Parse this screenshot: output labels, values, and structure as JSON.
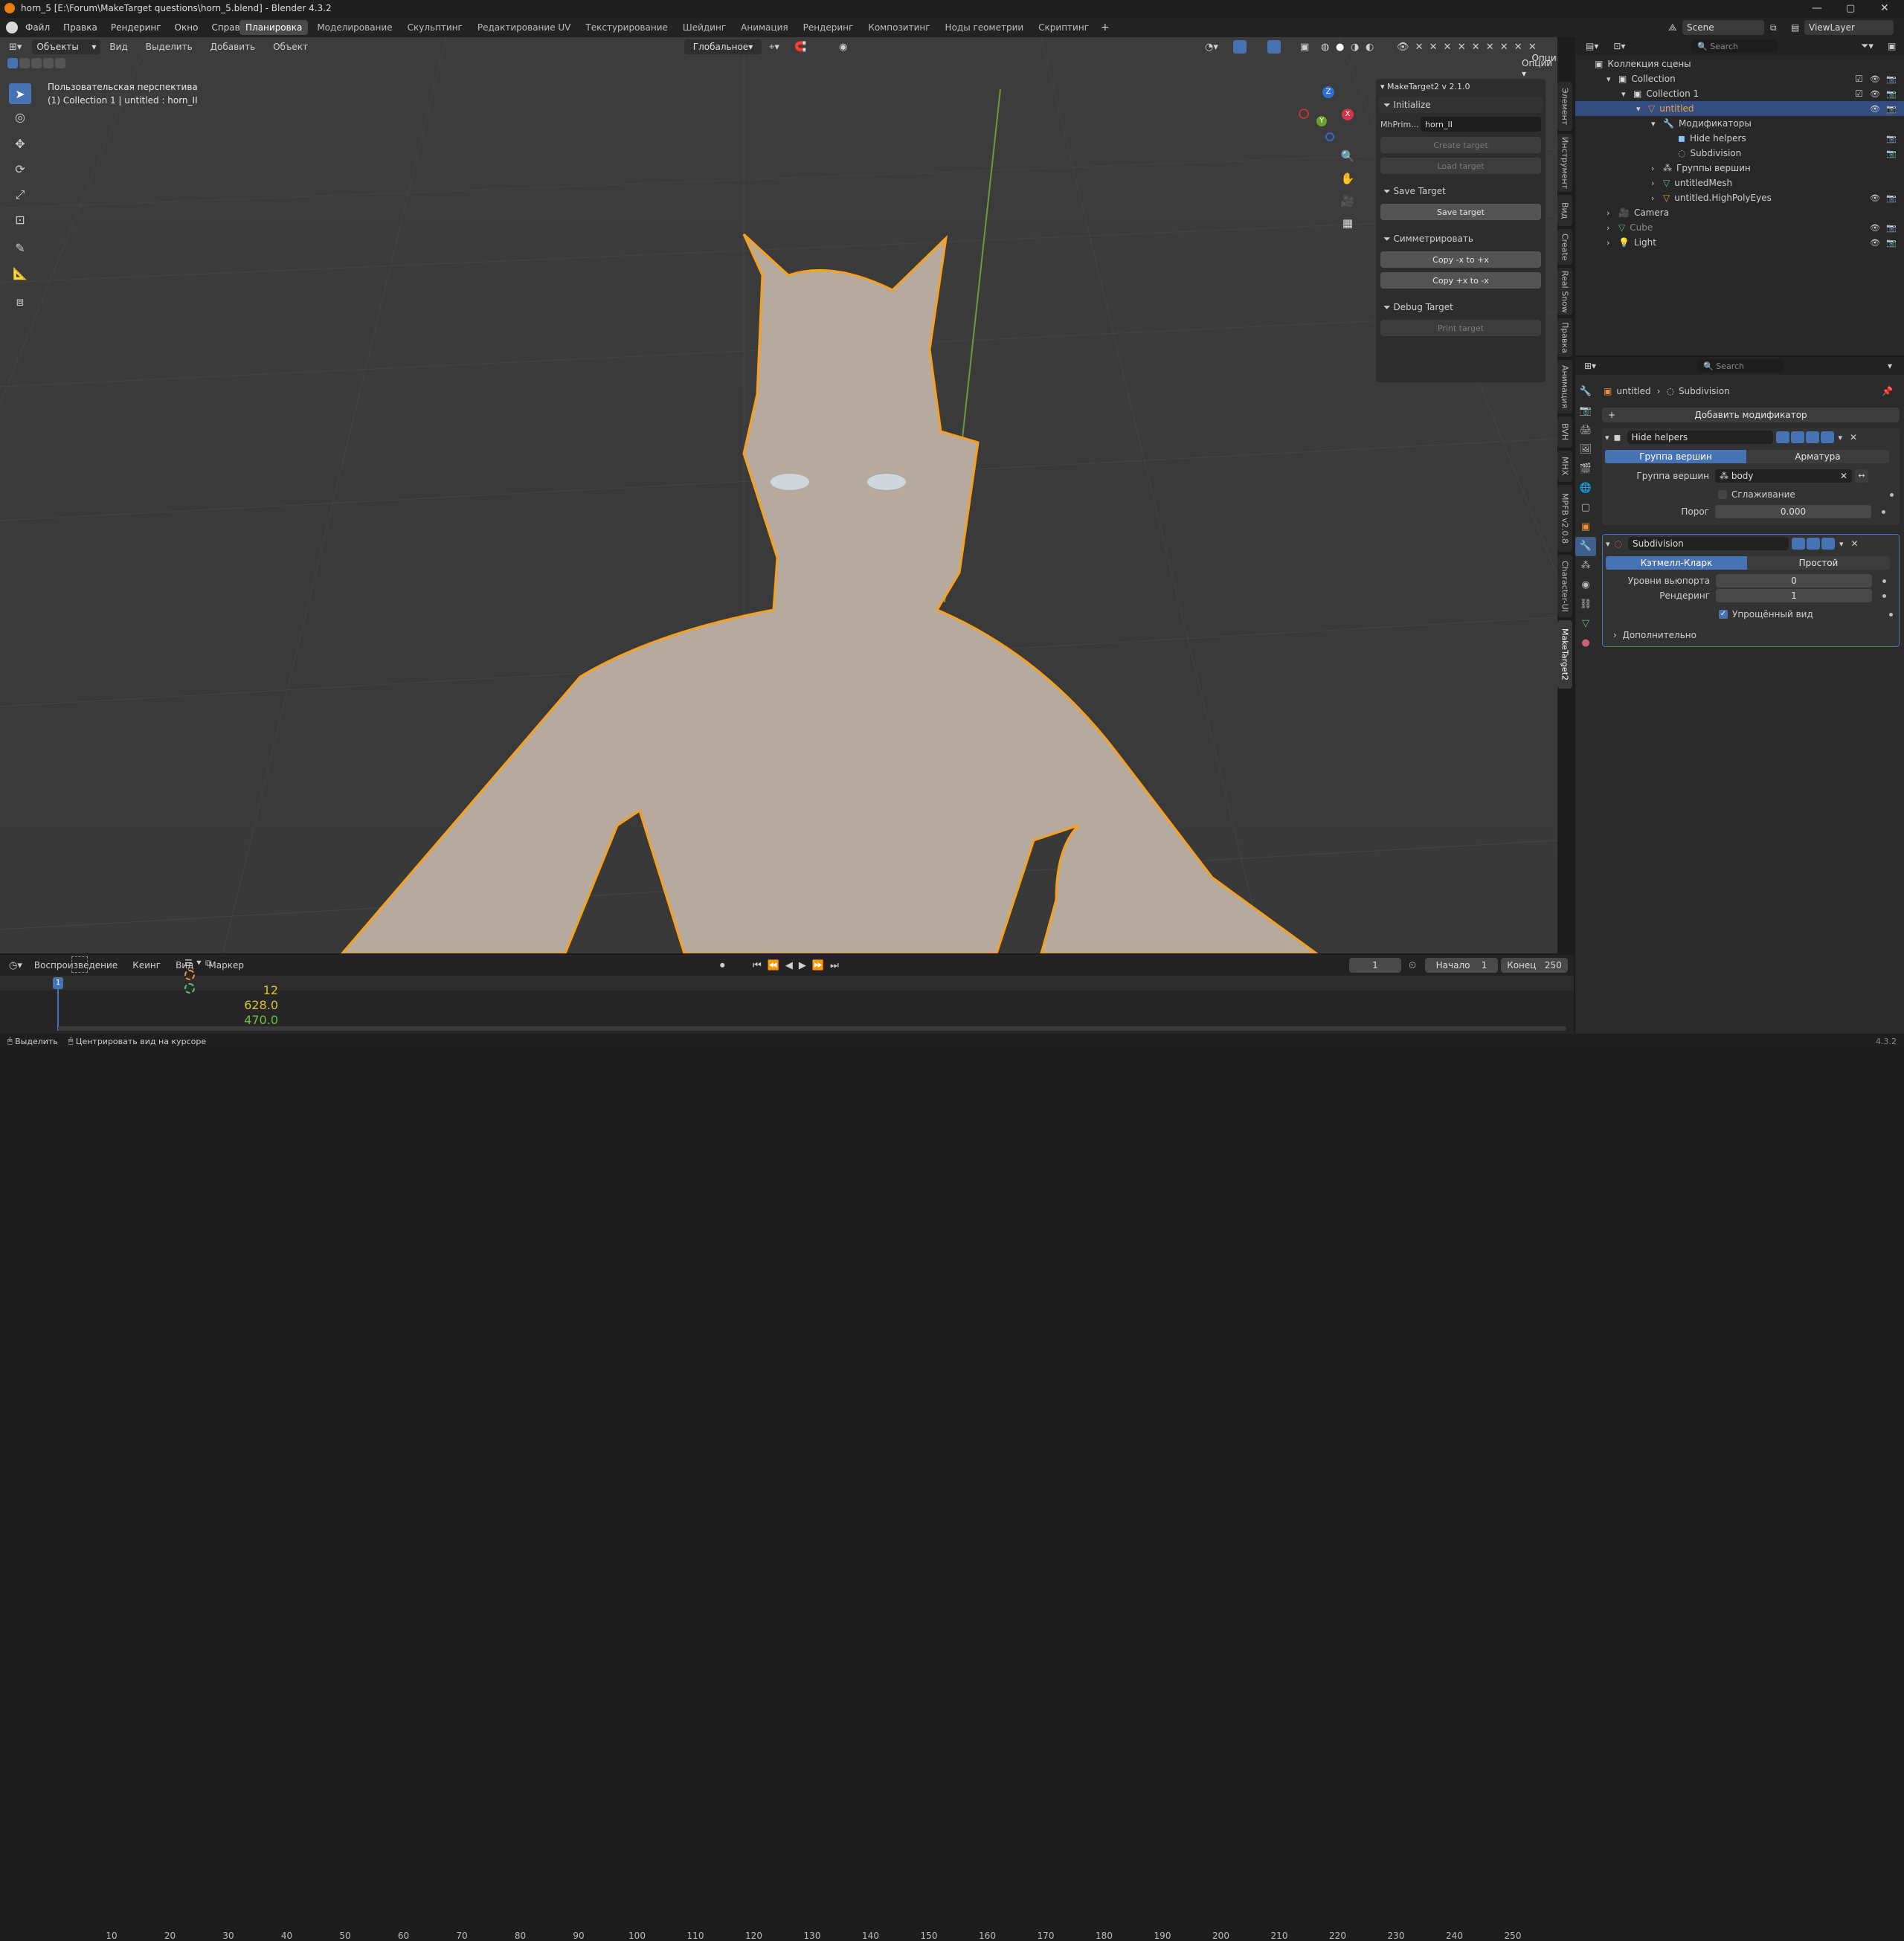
{
  "window": {
    "title": "horn_5 [E:\\Forum\\MakeTarget questions\\horn_5.blend] - Blender 4.3.2"
  },
  "menu": [
    "Файл",
    "Правка",
    "Рендеринг",
    "Окно",
    "Справка"
  ],
  "workspaces": [
    "Планировка",
    "Моделирование",
    "Скульптинг",
    "Редактирование UV",
    "Текстурирование",
    "Шейдинг",
    "Анимация",
    "Рендеринг",
    "Композитинг",
    "Ноды геометрии",
    "Скриптинг"
  ],
  "scene": {
    "name": "Scene",
    "viewlayer": "ViewLayer"
  },
  "viewport": {
    "mode": "Объекты",
    "menu": [
      "Вид",
      "Выделить",
      "Добавить",
      "Объект"
    ],
    "orientation": "Глобальное",
    "options": "Опции",
    "info_line1": "Пользовательская перспектива",
    "info_line2": "(1) Collection 1 | untitled : horn_II"
  },
  "maketarget": {
    "header": "MakeTarget2 v 2.1.0",
    "initialize": "Initialize",
    "field_label": "MhPrim...",
    "field_value": "horn_II",
    "create": "Create target",
    "load": "Load target",
    "save_section": "Save Target",
    "save_btn": "Save target",
    "sym_section": "Симметрировать",
    "copy1": "Copy -x to +x",
    "copy2": "Copy +x to -x",
    "debug_section": "Debug Target",
    "print": "Print target"
  },
  "side_tabs": [
    "Элемент",
    "Инструмент",
    "Вид",
    "Create",
    "Real Snow",
    "Правка",
    "Анимация",
    "BVH",
    "MHX",
    "MPFB v2.0.8",
    "Character-UI",
    "MakeTarget2"
  ],
  "outliner": {
    "search": "Search",
    "scene_collection": "Коллекция сцены",
    "items": [
      {
        "label": "Collection"
      },
      {
        "label": "Collection 1"
      },
      {
        "label": "untitled"
      },
      {
        "label": "Модификаторы"
      },
      {
        "label": "Hide helpers"
      },
      {
        "label": "Subdivision"
      },
      {
        "label": "Группы вершин"
      },
      {
        "label": "untitledMesh"
      },
      {
        "label": "untitled.HighPolyEyes"
      },
      {
        "label": "Camera"
      },
      {
        "label": "Cube"
      },
      {
        "label": "Light"
      }
    ]
  },
  "properties": {
    "search": "Search",
    "breadcrumb_obj": "untitled",
    "breadcrumb_mod": "Subdivision",
    "add_modifier": "Добавить модификатор",
    "mod1": {
      "name": "Hide helpers",
      "tab1": "Группа вершин",
      "tab2": "Арматура",
      "group_label": "Группа вершин",
      "group_value": "body",
      "smooth": "Сглаживание",
      "threshold_label": "Порог",
      "threshold": "0.000"
    },
    "mod2": {
      "name": "Subdivision",
      "tab1": "Кэтмелл-Кларк",
      "tab2": "Простой",
      "levels_label": "Уровни вьюпорта",
      "levels": "0",
      "render_label": "Рендеринг",
      "render": "1",
      "simple": "Упрощённый вид",
      "advanced": "Дополнительно"
    }
  },
  "timeline": {
    "menu": [
      "Воспроизведение",
      "Кеинг",
      "Вид",
      "Маркер"
    ],
    "current": "1",
    "start_label": "Начало",
    "start": "1",
    "end_label": "Конец",
    "end": "250",
    "ticks": [
      "10",
      "20",
      "30",
      "40",
      "50",
      "60",
      "70",
      "80",
      "90",
      "100",
      "110",
      "120",
      "130",
      "140",
      "150",
      "160",
      "170",
      "180",
      "190",
      "200",
      "210",
      "220",
      "230",
      "240",
      "250"
    ],
    "frame_marker": "1",
    "overlay": [
      "12",
      "628.0",
      "470.0"
    ]
  },
  "status": {
    "left1": "Выделить",
    "left2": "Центрировать вид на курсоре",
    "version": "4.3.2"
  }
}
